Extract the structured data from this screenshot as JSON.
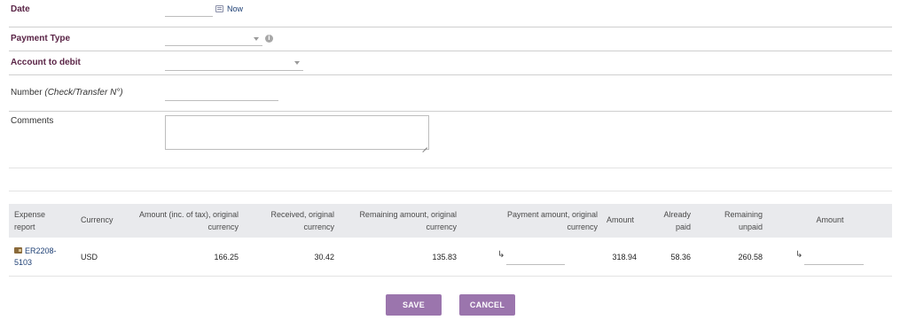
{
  "form": {
    "date_label": "Date",
    "date_now_link": "Now",
    "payment_type_label": "Payment Type",
    "info_symbol": "i",
    "account_label": "Account to debit",
    "number_label": "Number",
    "number_hint": "(Check/Transfer N°)",
    "comments_label": "Comments",
    "colors": {
      "required_label": "#5a2446",
      "link": "#1d3f74",
      "button": "#9b75ad",
      "header_bg": "#e9eaed"
    },
    "icons": [
      "calendar-icon",
      "info-icon",
      "dropdown-arrow-icon",
      "resize-grip-icon",
      "wallet-icon",
      "return-arrow-icon"
    ]
  },
  "table": {
    "headers": {
      "expense_report": "Expense report",
      "currency": "Currency",
      "amount_orig": "Amount (inc. of tax), original currency",
      "received_orig": "Received, original currency",
      "remaining_orig": "Remaining amount, original currency",
      "payment_orig": "Payment amount, original currency",
      "amount": "Amount",
      "already_paid": "Already paid",
      "remaining_unpaid": "Remaining unpaid",
      "amount_input": "Amount"
    },
    "rows": [
      {
        "ref": "ER2208-5103",
        "currency": "USD",
        "amount_orig": "166.25",
        "received_orig": "30.42",
        "remaining_orig": "135.83",
        "amount": "318.94",
        "already_paid": "58.36",
        "remaining_unpaid": "260.58",
        "arrow": "↳"
      }
    ]
  },
  "actions": {
    "save": "SAVE",
    "cancel": "CANCEL"
  }
}
